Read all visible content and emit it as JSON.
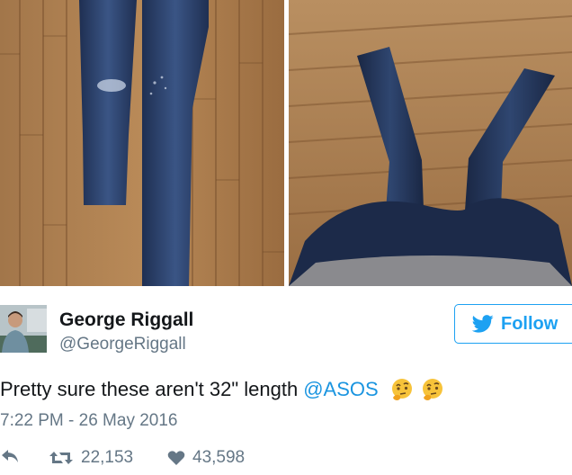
{
  "tweet": {
    "author": {
      "name": "George Riggall",
      "handle": "@GeorgeRiggall"
    },
    "follow_label": "Follow",
    "text": "Pretty sure these aren't 32\" length",
    "mention": "@ASOS",
    "emojis": [
      "thinking-face",
      "thinking-face"
    ],
    "timestamp": "7:22 PM - 26 May 2016",
    "retweets": "22,153",
    "likes": "43,598"
  },
  "colors": {
    "brand_blue": "#1da1f2",
    "link_blue": "#1b95e0",
    "secondary_text": "#657786"
  }
}
